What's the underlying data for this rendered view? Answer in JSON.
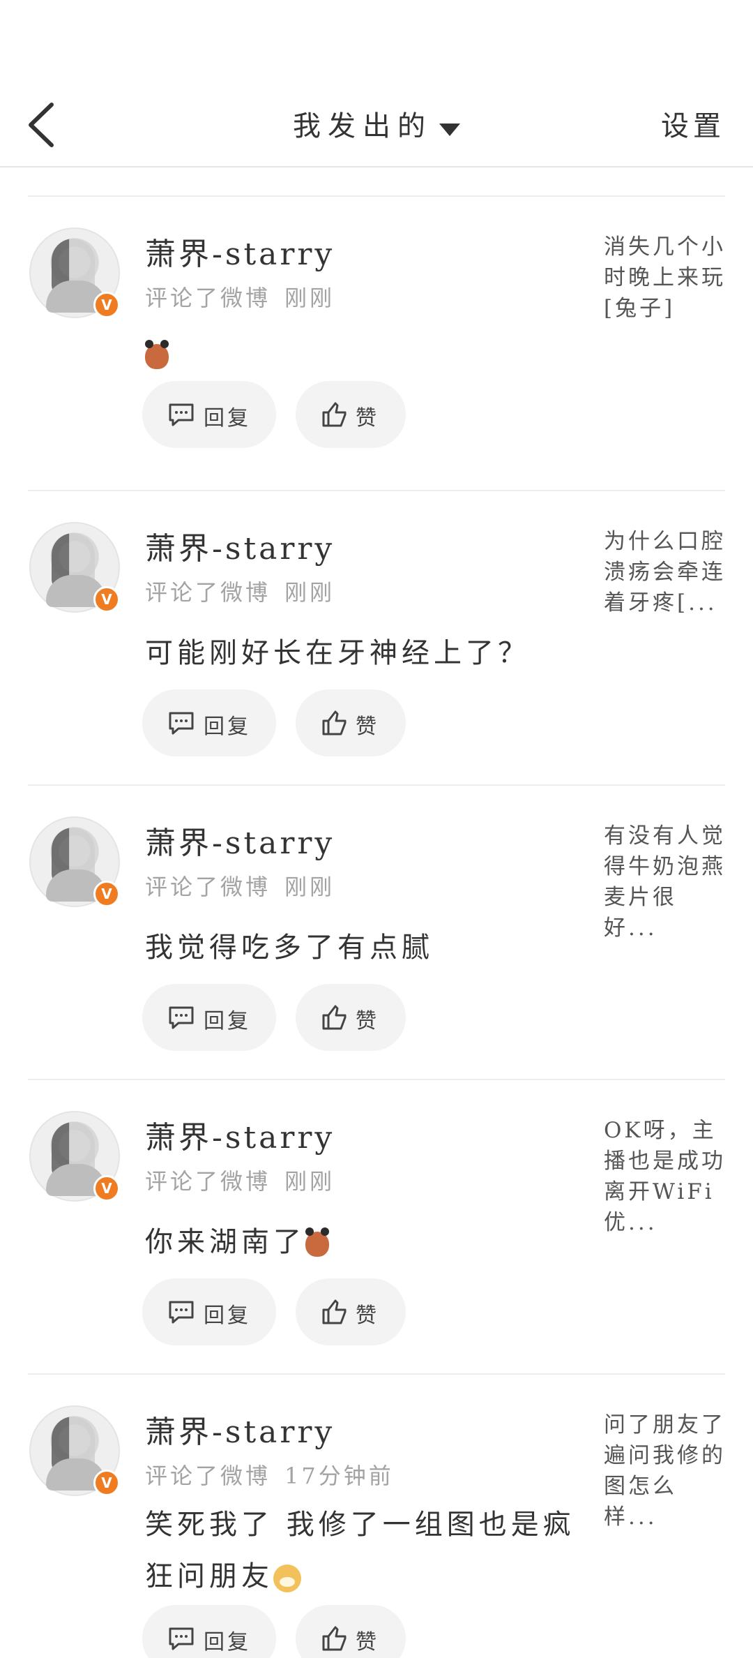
{
  "header": {
    "title": "我发出的",
    "settings_label": "设置"
  },
  "actions": {
    "reply_label": "回复",
    "like_label": "赞"
  },
  "comments": [
    {
      "user": "萧界-starry",
      "action": "评论了微博",
      "time": "刚刚",
      "text": "",
      "emoji": "face-emoji",
      "snippet": "消失几个小时晚上来玩[兔子]"
    },
    {
      "user": "萧界-starry",
      "action": "评论了微博",
      "time": "刚刚",
      "text": "可能刚好长在牙神经上了？",
      "snippet": "为什么口腔溃疡会牵连着牙疼[..."
    },
    {
      "user": "萧界-starry",
      "action": "评论了微博",
      "time": "刚刚",
      "text": "我觉得吃多了有点腻",
      "snippet": "有没有人觉得牛奶泡燕麦片很好..."
    },
    {
      "user": "萧界-starry",
      "action": "评论了微博",
      "time": "刚刚",
      "text": "你来湖南了",
      "emoji": "face-emoji",
      "snippet": "OK呀，主播也是成功离开WiFi优..."
    },
    {
      "user": "萧界-starry",
      "action": "评论了微博",
      "time": "17分钟前",
      "text": "笑死我了 我修了一组图也是疯狂问朋友",
      "emoji": "doge-emoji",
      "snippet": "问了朋友了遍问我修的图怎么样..."
    }
  ],
  "colors": {
    "badge": "#f07c22",
    "pill_bg": "#f3f3f3",
    "meta_text": "#a3a3a3"
  }
}
